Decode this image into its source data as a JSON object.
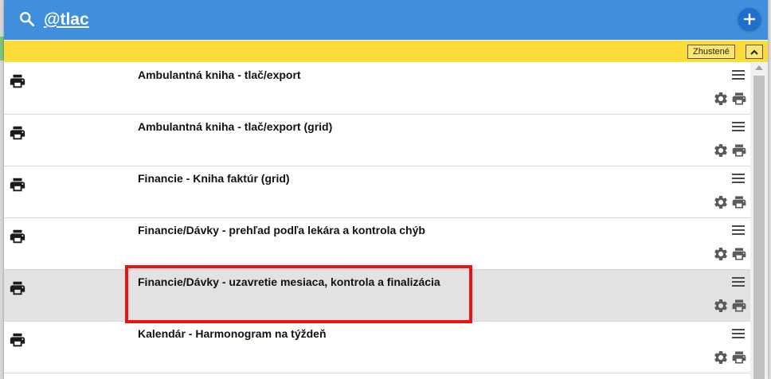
{
  "search": {
    "value": "@tlac",
    "icon": "search-icon"
  },
  "toolbar": {
    "density_label": "Zhustené",
    "collapse_icon": "chevron-up-icon",
    "add_icon": "plus-icon"
  },
  "colors": {
    "header_bg": "#3f8fdc",
    "toolbar_bg": "#fddc3a",
    "selected_row_bg": "#e2e2e2",
    "highlight_border": "#ee1111"
  },
  "rows": [
    {
      "title": "Ambulantná kniha - tlač/export",
      "selected": false
    },
    {
      "title": "Ambulantná kniha - tlač/export (grid)",
      "selected": false
    },
    {
      "title": "Financie - Kniha faktúr (grid)",
      "selected": false
    },
    {
      "title": "Financie/Dávky - prehľad podľa lekára a kontrola chýb",
      "selected": false
    },
    {
      "title": "Financie/Dávky - uzavretie mesiaca, kontrola a finalizácia",
      "selected": true
    },
    {
      "title": "Kalendár - Harmonogram na týždeň",
      "selected": false
    }
  ]
}
